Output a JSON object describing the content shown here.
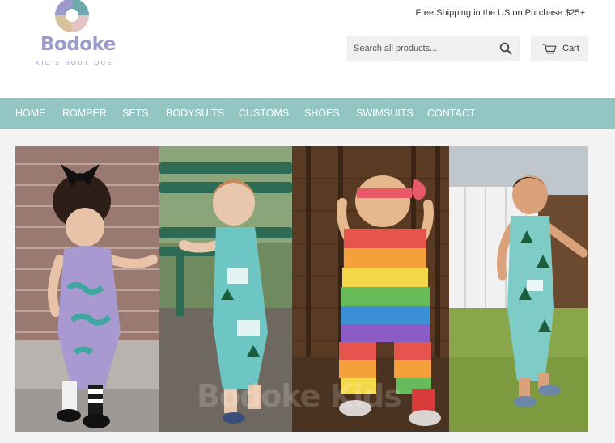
{
  "header": {
    "logo": {
      "name": "Bodoke",
      "tagline": "KID'S BOUTIQUE"
    },
    "promo_text": "Free Shipping in the US on Purchase $25+",
    "search": {
      "placeholder": "Search all products...",
      "icon": "search-icon"
    },
    "cart": {
      "label": "Cart",
      "icon": "cart-icon"
    }
  },
  "nav": {
    "items": [
      {
        "label": "HOME"
      },
      {
        "label": "ROMPER"
      },
      {
        "label": "SETS"
      },
      {
        "label": "BODYSUITS"
      },
      {
        "label": "CUSTOMS"
      },
      {
        "label": "SHOES"
      },
      {
        "label": "SWIMSUITS"
      },
      {
        "label": "CONTACT"
      }
    ]
  },
  "hero": {
    "watermark": "Bodoke Kids"
  },
  "colors": {
    "nav_bg": "#93c6c3",
    "logo": "#9b9ac9",
    "page_bg": "#f3f3f3"
  }
}
